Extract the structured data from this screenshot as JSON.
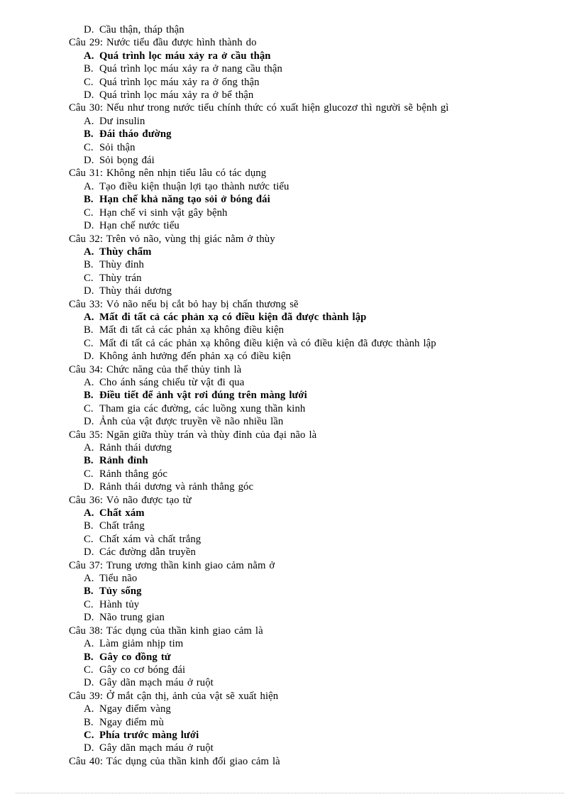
{
  "document": {
    "type": "multiple-choice-exam",
    "language": "vi",
    "orphan_option": {
      "letter": "D.",
      "text": "Cầu thận, tháp thận",
      "bold": false
    },
    "questions": [
      {
        "number": "Câu 29:",
        "prompt": "Câu 29: Nước tiểu đầu được hình thành do",
        "options": [
          {
            "letter": "A.",
            "text": "Quá trình lọc máu xảy ra ở cầu thận",
            "bold": true
          },
          {
            "letter": "B.",
            "text": "Quá trình lọc máu xảy ra ở nang cầu thận",
            "bold": false
          },
          {
            "letter": "C.",
            "text": "Quá trình lọc máu xảy ra ở ống thận",
            "bold": false
          },
          {
            "letter": "D.",
            "text": "Quá trình lọc máu xảy ra ở bể thận",
            "bold": false
          }
        ]
      },
      {
        "number": "Câu 30:",
        "prompt": "Câu 30: Nếu như trong nước tiểu chính thức có xuất hiện glucozơ thì người sẽ bệnh gì",
        "options": [
          {
            "letter": "A.",
            "text": "Dư insulin",
            "bold": false
          },
          {
            "letter": "B.",
            "text": "Đái tháo đường",
            "bold": true
          },
          {
            "letter": "C.",
            "text": "Sỏi thận",
            "bold": false
          },
          {
            "letter": "D.",
            "text": "Sỏi bọng đái",
            "bold": false
          }
        ]
      },
      {
        "number": "Câu 31:",
        "prompt": "Câu 31: Không nên nhịn tiểu lâu có tác dụng",
        "options": [
          {
            "letter": "A.",
            "text": "Tạo điều kiện thuận lợi tạo thành nước tiểu",
            "bold": false
          },
          {
            "letter": "B.",
            "text": "Hạn chế khả năng tạo sỏi ở bóng đái",
            "bold": true
          },
          {
            "letter": "C.",
            "text": "Hạn chế vi sinh vật gây bệnh",
            "bold": false
          },
          {
            "letter": "D.",
            "text": "Hạn chế nước tiểu",
            "bold": false
          }
        ]
      },
      {
        "number": "Câu 32:",
        "prompt": "Câu 32: Trên vỏ não, vùng thị giác nằm ở thùy",
        "options": [
          {
            "letter": "A.",
            "text": "Thùy chẩm",
            "bold": true
          },
          {
            "letter": "B.",
            "text": "Thùy đỉnh",
            "bold": false
          },
          {
            "letter": "C.",
            "text": "Thùy trán",
            "bold": false
          },
          {
            "letter": "D.",
            "text": "Thùy thái dương",
            "bold": false
          }
        ]
      },
      {
        "number": "Câu 33:",
        "prompt": "Câu 33: Vỏ não nếu bị cắt bỏ hay bị chấn thương sẽ",
        "options": [
          {
            "letter": "A.",
            "text": "Mất đi tất cả các phản xạ có điều kiện đã được thành lập",
            "bold": true
          },
          {
            "letter": "B.",
            "text": "Mất đi tất cả các phản xạ không điều kiện",
            "bold": false
          },
          {
            "letter": "C.",
            "text": "Mất đi tất cả các phản xạ không điều kiện và có điều kiện đã được thành lập",
            "bold": false
          },
          {
            "letter": "D.",
            "text": "Không ảnh hưởng đến phản xạ có điều kiện",
            "bold": false
          }
        ]
      },
      {
        "number": "Câu 34:",
        "prompt": "Câu 34: Chức năng của thể thủy tinh là",
        "options": [
          {
            "letter": "A.",
            "text": "Cho ánh sáng chiếu từ vật đi qua",
            "bold": false
          },
          {
            "letter": "B.",
            "text": "Điều tiết để ảnh vật rơi đúng trên màng lưới",
            "bold": true
          },
          {
            "letter": "C.",
            "text": "Tham gia các đường, các luồng xung thần kinh",
            "bold": false
          },
          {
            "letter": "D.",
            "text": "Ảnh của vật được truyền về não nhiều lần",
            "bold": false
          }
        ]
      },
      {
        "number": "Câu 35:",
        "prompt": "Câu 35: Ngăn giữa thùy trán và thùy đỉnh của đại não là",
        "options": [
          {
            "letter": "A.",
            "text": "Rảnh thái dương",
            "bold": false
          },
          {
            "letter": "B.",
            "text": "Rảnh đỉnh",
            "bold": true
          },
          {
            "letter": "C.",
            "text": "Rảnh thẳng góc",
            "bold": false
          },
          {
            "letter": "D.",
            "text": "Rảnh thái dương và rảnh thẳng góc",
            "bold": false
          }
        ]
      },
      {
        "number": "Câu 36:",
        "prompt": "Câu 36: Vỏ não được tạo từ",
        "options": [
          {
            "letter": "A.",
            "text": "Chất xám",
            "bold": true
          },
          {
            "letter": "B.",
            "text": "Chất trắng",
            "bold": false
          },
          {
            "letter": "C.",
            "text": "Chất xám và chất trắng",
            "bold": false
          },
          {
            "letter": "D.",
            "text": "Các đường dẫn truyền",
            "bold": false
          }
        ]
      },
      {
        "number": "Câu 37:",
        "prompt": "Câu 37: Trung ương thần kinh giao cảm nằm ở",
        "options": [
          {
            "letter": "A.",
            "text": "Tiểu não",
            "bold": false
          },
          {
            "letter": "B.",
            "text": "Tủy sống",
            "bold": true
          },
          {
            "letter": "C.",
            "text": "Hành tủy",
            "bold": false
          },
          {
            "letter": "D.",
            "text": "Não trung gian",
            "bold": false
          }
        ]
      },
      {
        "number": "Câu 38:",
        "prompt": "Câu 38: Tác dụng của thần kinh giao cảm là",
        "options": [
          {
            "letter": "A.",
            "text": "Làm giảm nhịp tim",
            "bold": false
          },
          {
            "letter": "B.",
            "text": "Gây co đồng tử",
            "bold": true
          },
          {
            "letter": "C.",
            "text": "Gây co cơ bóng đái",
            "bold": false
          },
          {
            "letter": "D.",
            "text": "Gây dãn mạch máu ở ruột",
            "bold": false
          }
        ]
      },
      {
        "number": "Câu 39:",
        "prompt": "Câu 39: Ở mắt cận thị, ảnh của vật sẽ xuất hiện",
        "options": [
          {
            "letter": "A.",
            "text": "Ngay điểm vàng",
            "bold": false
          },
          {
            "letter": "B.",
            "text": "Ngay điểm mù",
            "bold": false
          },
          {
            "letter": "C.",
            "text": "Phía trước màng lưới",
            "bold": true
          },
          {
            "letter": "D.",
            "text": "Gây dãn mạch máu ở ruột",
            "bold": false
          }
        ]
      },
      {
        "number": "Câu 40:",
        "prompt": "Câu 40: Tác dụng của thần kinh đối giao cảm là",
        "options": []
      }
    ]
  }
}
